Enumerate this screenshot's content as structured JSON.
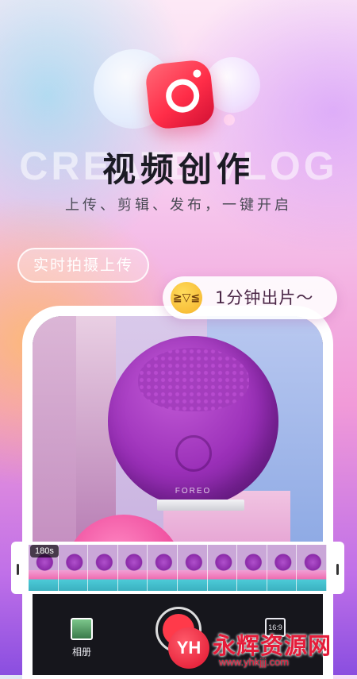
{
  "hero": {
    "background_word": "CREATE VLOG",
    "title": "视频创作",
    "subtitle": "上传、剪辑、发布，一键开启"
  },
  "realtime_pill": {
    "label": "实时拍摄上传"
  },
  "speech_bubble": {
    "emoji_icon": "laughing-face-icon",
    "text": "1分钟出片～"
  },
  "preview": {
    "brand_text": "FOREO",
    "duration_badge": "180s",
    "frame_count": 10
  },
  "controls": {
    "album_label": "相册",
    "ratio_label": "16:9",
    "record_color": "#ff3a4a"
  },
  "watermark": {
    "logo_glyph": "YH",
    "title": "永辉资源网",
    "url": "www.yhkjjj.com"
  },
  "colors": {
    "accent_red": "#ff2d48",
    "watermark_red": "#e51c3a",
    "bottom_bar": "#16161c"
  }
}
